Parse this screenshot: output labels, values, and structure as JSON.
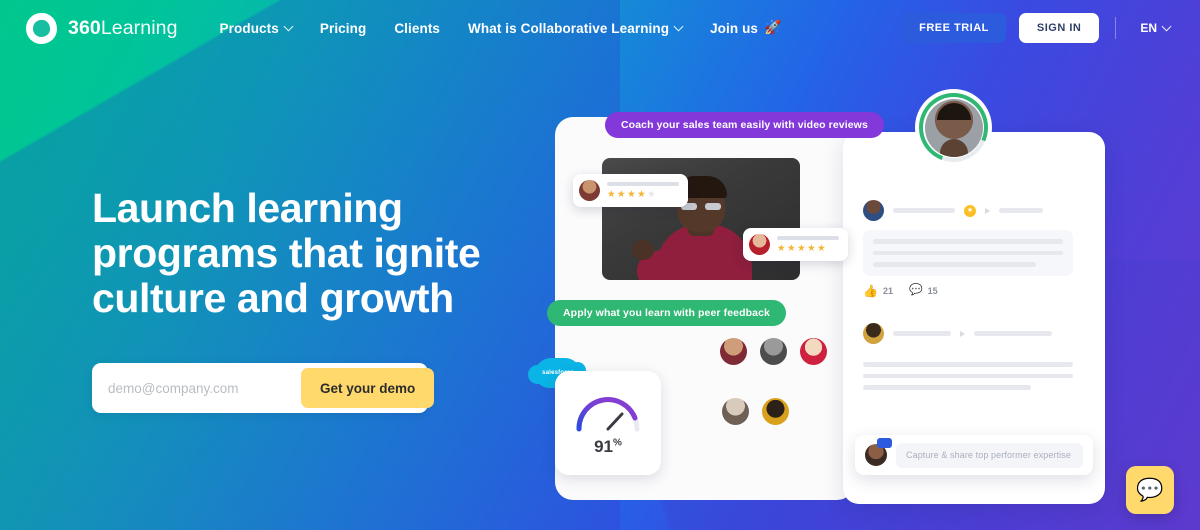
{
  "nav": {
    "brand_bold": "360",
    "brand_light": "Learning",
    "logo_icon": "360learning-circle-logo",
    "links": [
      {
        "label": "Products",
        "has_chevron": true
      },
      {
        "label": "Pricing",
        "has_chevron": false
      },
      {
        "label": "Clients",
        "has_chevron": false
      },
      {
        "label": "What is Collaborative Learning",
        "has_chevron": true
      },
      {
        "label": "Join us",
        "has_chevron": false,
        "emoji": "🚀"
      }
    ],
    "free_trial_label": "FREE TRIAL",
    "sign_in_label": "SIGN IN",
    "language": "EN"
  },
  "hero": {
    "headline": "Launch learning programs that ignite culture and growth",
    "email_placeholder": "demo@company.com",
    "email_value": "",
    "cta_label": "Get your demo"
  },
  "illustration": {
    "pill_purple": "Coach your sales team easily with video reviews",
    "pill_green": "Apply what you learn with peer feedback",
    "gauge": {
      "value": "91",
      "unit": "%",
      "percent": 91
    },
    "salesforce_badge": "salesforce",
    "review_cards": [
      {
        "stars_filled": 4,
        "stars_total": 5
      },
      {
        "stars_filled": 5,
        "stars_total": 5
      }
    ],
    "comments": [
      {
        "likes": "21",
        "replies": "15",
        "has_badge": true
      },
      {
        "likes": "",
        "replies": "",
        "has_badge": false
      }
    ],
    "compose_placeholder": "Capture & share top performer expertise"
  },
  "chat": {
    "icon": "speech-bubble-icon",
    "color": "#ffd96b"
  },
  "colors": {
    "gradient_start": "#00c88c",
    "gradient_mid": "#1784da",
    "gradient_end": "#6739cf",
    "accent_blue": "#2d5bde",
    "accent_yellow": "#ffd96b",
    "pill_purple": "#8338d9",
    "pill_green": "#2fb774"
  }
}
